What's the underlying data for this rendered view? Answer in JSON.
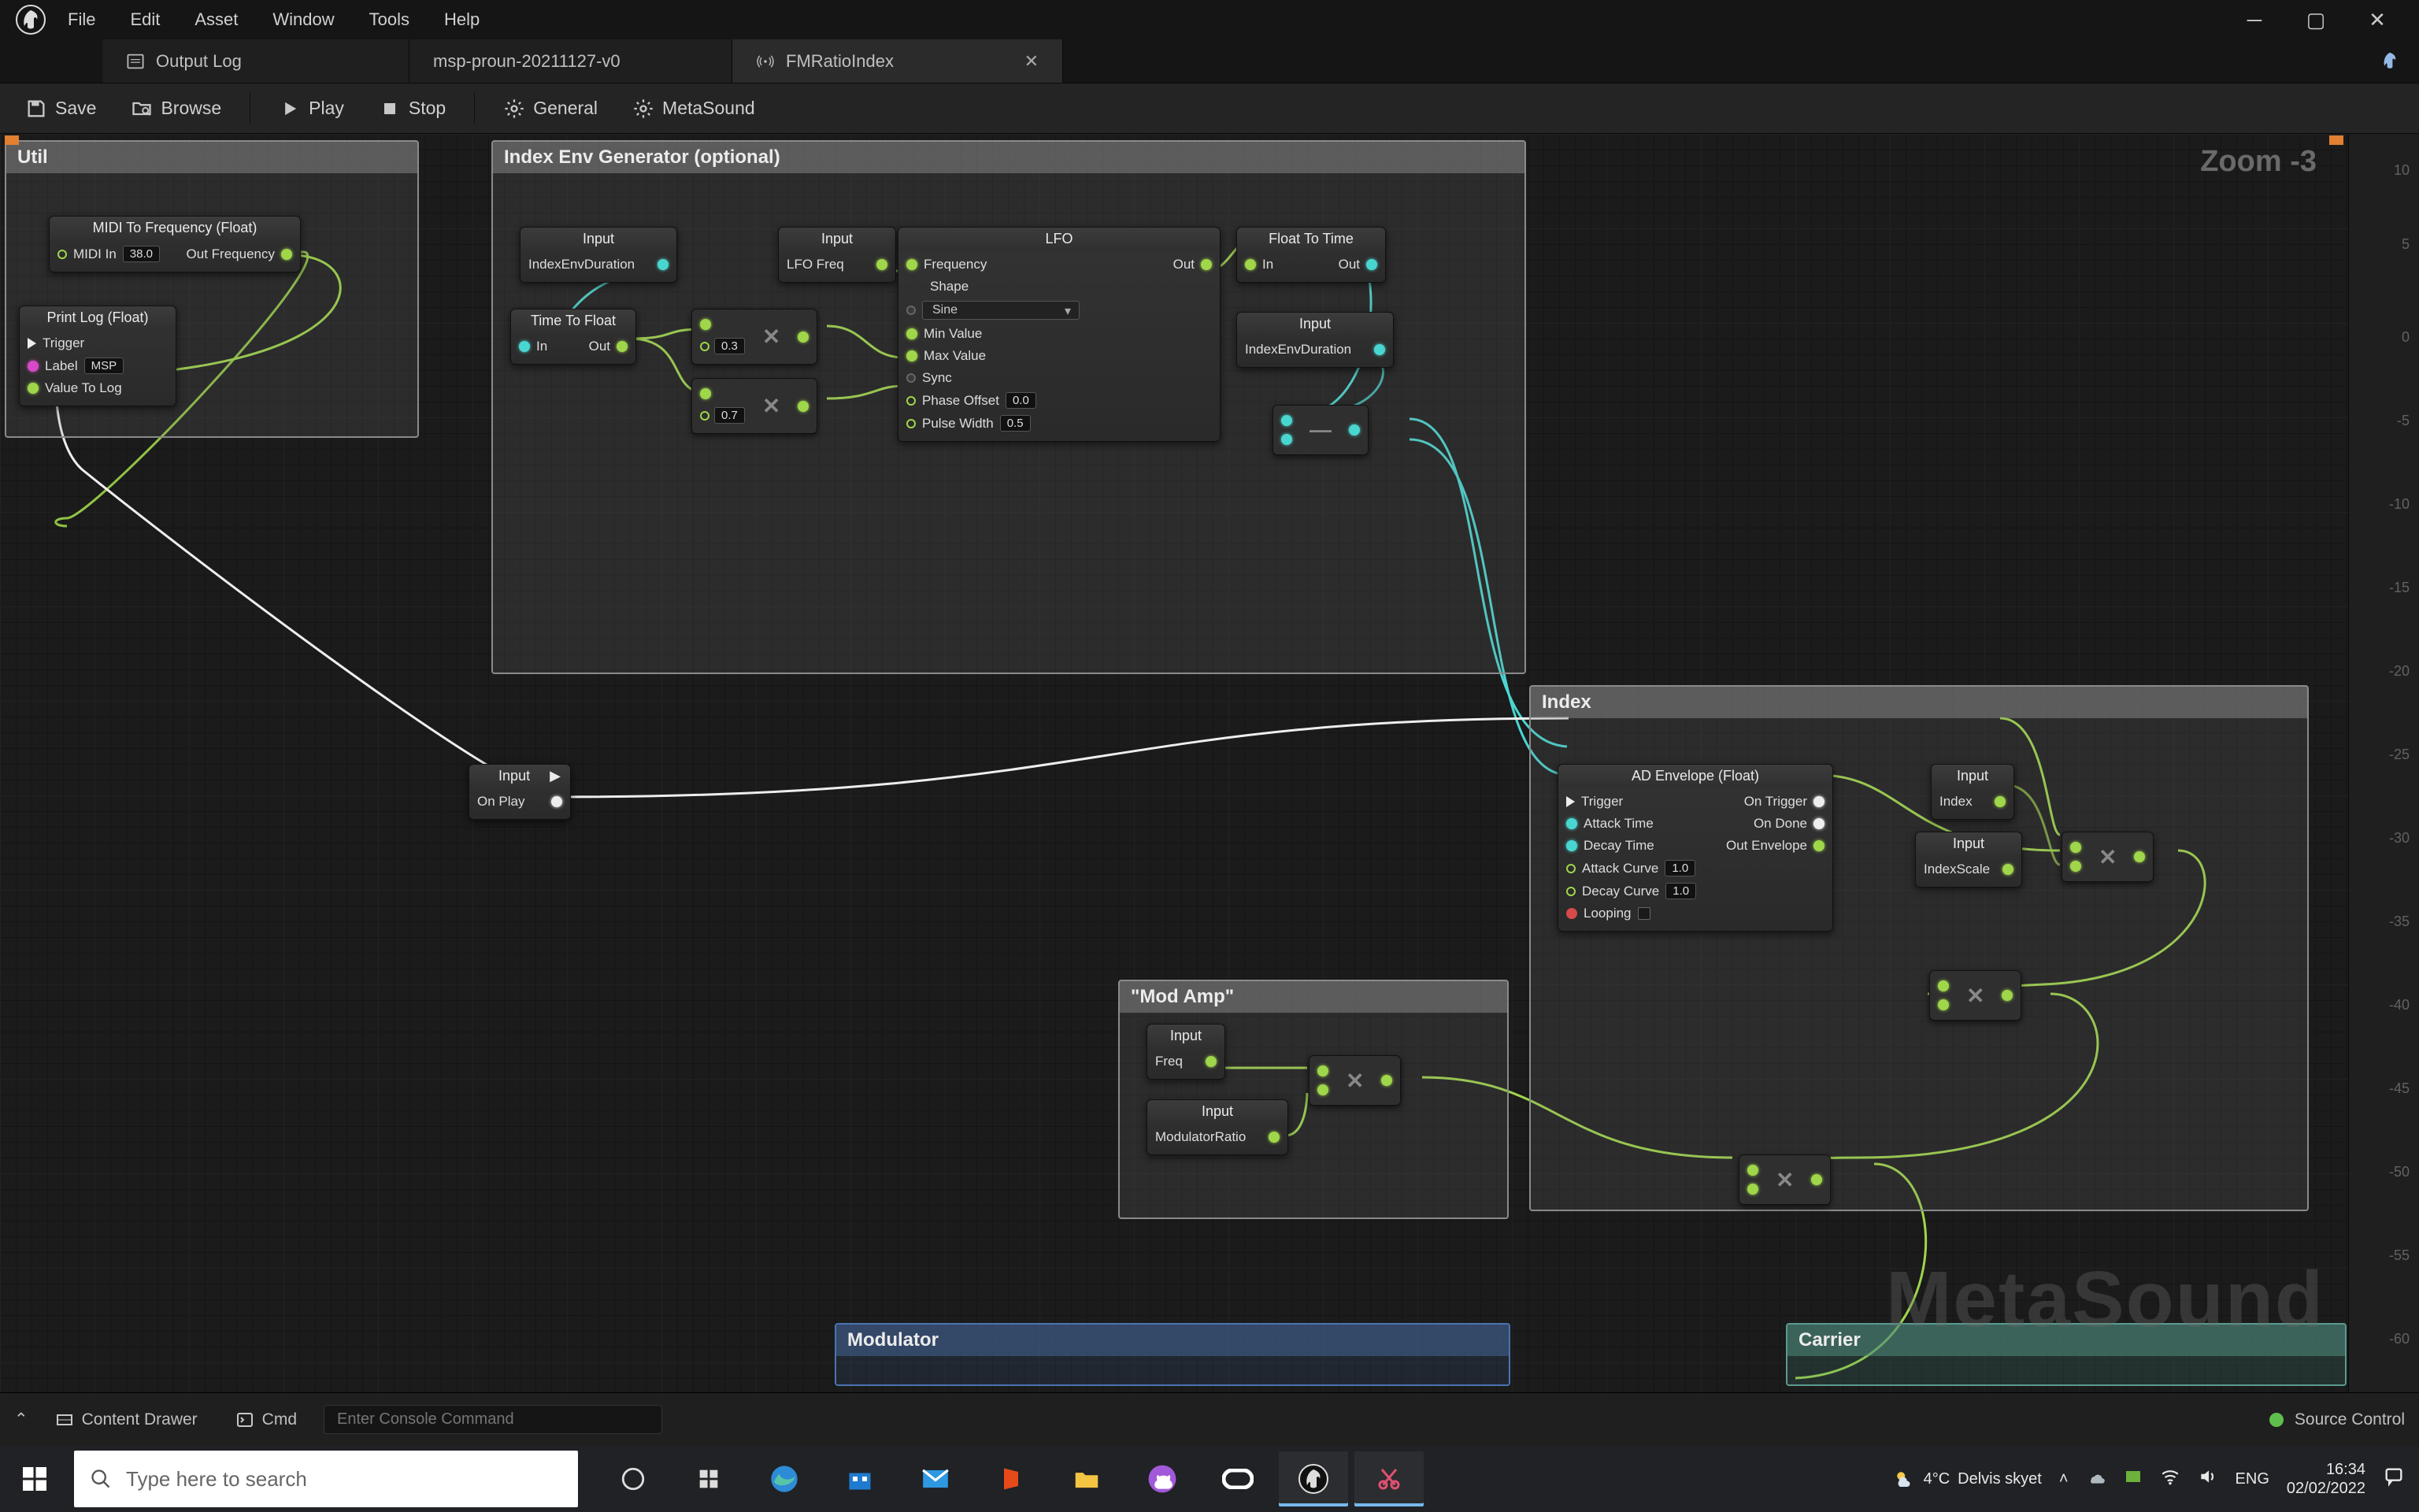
{
  "menu": {
    "file": "File",
    "edit": "Edit",
    "asset": "Asset",
    "window": "Window",
    "tools": "Tools",
    "help": "Help"
  },
  "tabs": {
    "t0": {
      "label": "Output Log"
    },
    "t1": {
      "label": "msp-proun-20211127-v0"
    },
    "t2": {
      "label": "FMRatioIndex"
    }
  },
  "toolbar": {
    "save": "Save",
    "browse": "Browse",
    "play": "Play",
    "stop": "Stop",
    "general": "General",
    "metasound": "MetaSound"
  },
  "canvas": {
    "zoom": "Zoom -3",
    "watermark": "MetaSound",
    "ruler": {
      "m10": "10",
      "m5": "5",
      "m0": "0",
      "mn5": "-5",
      "mn10": "-10",
      "mn15": "-15",
      "mn20": "-20",
      "mn25": "-25",
      "mn30": "-30",
      "mn35": "-35",
      "mn40": "-40",
      "mn45": "-45",
      "mn50": "-50",
      "mn55": "-55",
      "mn60": "-60"
    }
  },
  "comments": {
    "util": "Util",
    "indexenv": "Index Env Generator (optional)",
    "modamp": "\"Mod Amp\"",
    "index": "Index",
    "modulator": "Modulator",
    "carrier": "Carrier"
  },
  "nodes": {
    "midi": {
      "title": "MIDI To Frequency (Float)",
      "in_label": "MIDI In",
      "in_val": "38.0",
      "out": "Out Frequency"
    },
    "print": {
      "title": "Print Log (Float)",
      "trigger": "Trigger",
      "label": "Label",
      "label_val": "MSP",
      "val": "Value To Log"
    },
    "in_indexenvdur": {
      "title": "Input",
      "pin": "IndexEnvDuration"
    },
    "ttf": {
      "title": "Time To Float",
      "in": "In",
      "out": "Out"
    },
    "mul1_val": "0.3",
    "mul2_val": "0.7",
    "in_lfofreq": {
      "title": "Input",
      "pin": "LFO Freq"
    },
    "lfo": {
      "title": "LFO",
      "freq": "Frequency",
      "shape": "Shape",
      "shape_opt": "Sine",
      "min": "Min Value",
      "max": "Max Value",
      "sync": "Sync",
      "phase": "Phase Offset",
      "phase_val": "0.0",
      "pulse": "Pulse Width",
      "pulse_val": "0.5",
      "out": "Out"
    },
    "ftt": {
      "title": "Float To Time",
      "in": "In",
      "out": "Out"
    },
    "in_indexenvdur2": {
      "title": "Input",
      "pin": "IndexEnvDuration"
    },
    "onplay": {
      "title": "Input",
      "pin": "On Play",
      "arrow": "▶"
    },
    "ad": {
      "title": "AD Envelope (Float)",
      "trigger": "Trigger",
      "attack": "Attack Time",
      "decay": "Decay Time",
      "ac": "Attack Curve",
      "ac_val": "1.0",
      "dc": "Decay Curve",
      "dc_val": "1.0",
      "loop": "Looping",
      "ontrig": "On Trigger",
      "ondone": "On Done",
      "outenv": "Out Envelope"
    },
    "in_index": {
      "title": "Input",
      "pin": "Index"
    },
    "in_indexscale": {
      "title": "Input",
      "pin": "IndexScale"
    },
    "in_freq": {
      "title": "Input",
      "pin": "Freq"
    },
    "in_modratio": {
      "title": "Input",
      "pin": "ModulatorRatio"
    }
  },
  "status": {
    "drawer": "Content Drawer",
    "cmd": "Cmd",
    "placeholder": "Enter Console Command",
    "source": "Source Control"
  },
  "taskbar": {
    "search": "Type here to search",
    "tray": {
      "weather_temp": "4°C",
      "weather_label": "Delvis skyet",
      "lang": "ENG",
      "time": "16:34",
      "date": "02/02/2022"
    }
  }
}
